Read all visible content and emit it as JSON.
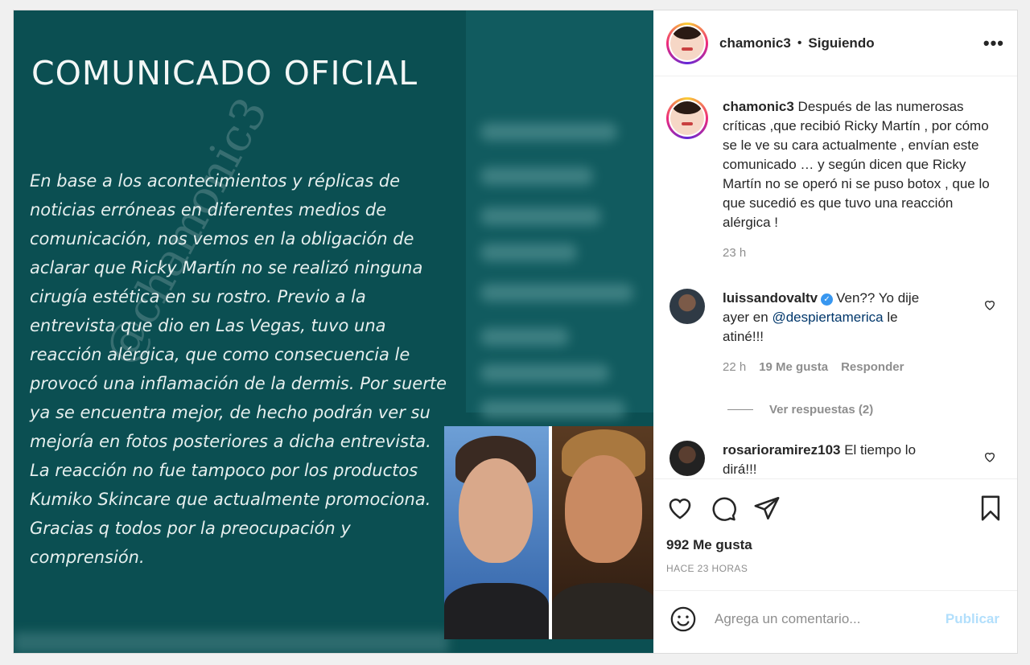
{
  "media": {
    "title": "COMUNICADO OFICIAL",
    "statement": "En base a los acontecimientos y réplicas de noticias erróneas en diferentes medios de comunicación, nos vemos en la obligación de aclarar que Ricky Martín no se realizó ninguna cirugía estética en su rostro. Previo a la entrevista que dio en Las Vegas, tuvo una reacción alérgica, que como consecuencia le provocó una inflamación de la dermis. Por suerte ya se encuentra mejor, de hecho podrán ver su mejoría en fotos posteriores a dicha entrevista. La reacción no fue tampoco por los productos Kumiko Skincare que actualmente promociona. Gracias q todos por la preocupación y comprensión.",
    "watermark": "@chamonic3"
  },
  "header": {
    "username": "chamonic3",
    "separator": "•",
    "follow_status": "Siguiendo",
    "more": "•••"
  },
  "caption": {
    "username": "chamonic3",
    "text": "Después de las numerosas críticas ,que recibió Ricky Martín , por cómo se le ve su cara actualmente , envían este comunicado … y según dicen que Ricky Martín no se operó ni se puso botox , que lo que sucedió es que tuvo una reacción alérgica !",
    "time": "23 h"
  },
  "comments": [
    {
      "username": "luissandovaltv",
      "text_before": "Ven?? Yo dije ayer en ",
      "mention": "@despiertamerica",
      "text_after": " le atiné!!!",
      "time": "22 h",
      "likes": "19 Me gusta",
      "reply": "Responder",
      "view_replies": "Ver respuestas (2)"
    },
    {
      "username": "rosarioramirez103",
      "text": "El tiempo lo dirá!!!"
    }
  ],
  "actions": {
    "likes": "992 Me gusta",
    "posted": "HACE 23 HORAS"
  },
  "add_comment": {
    "placeholder": "Agrega un comentario...",
    "publish": "Publicar"
  }
}
